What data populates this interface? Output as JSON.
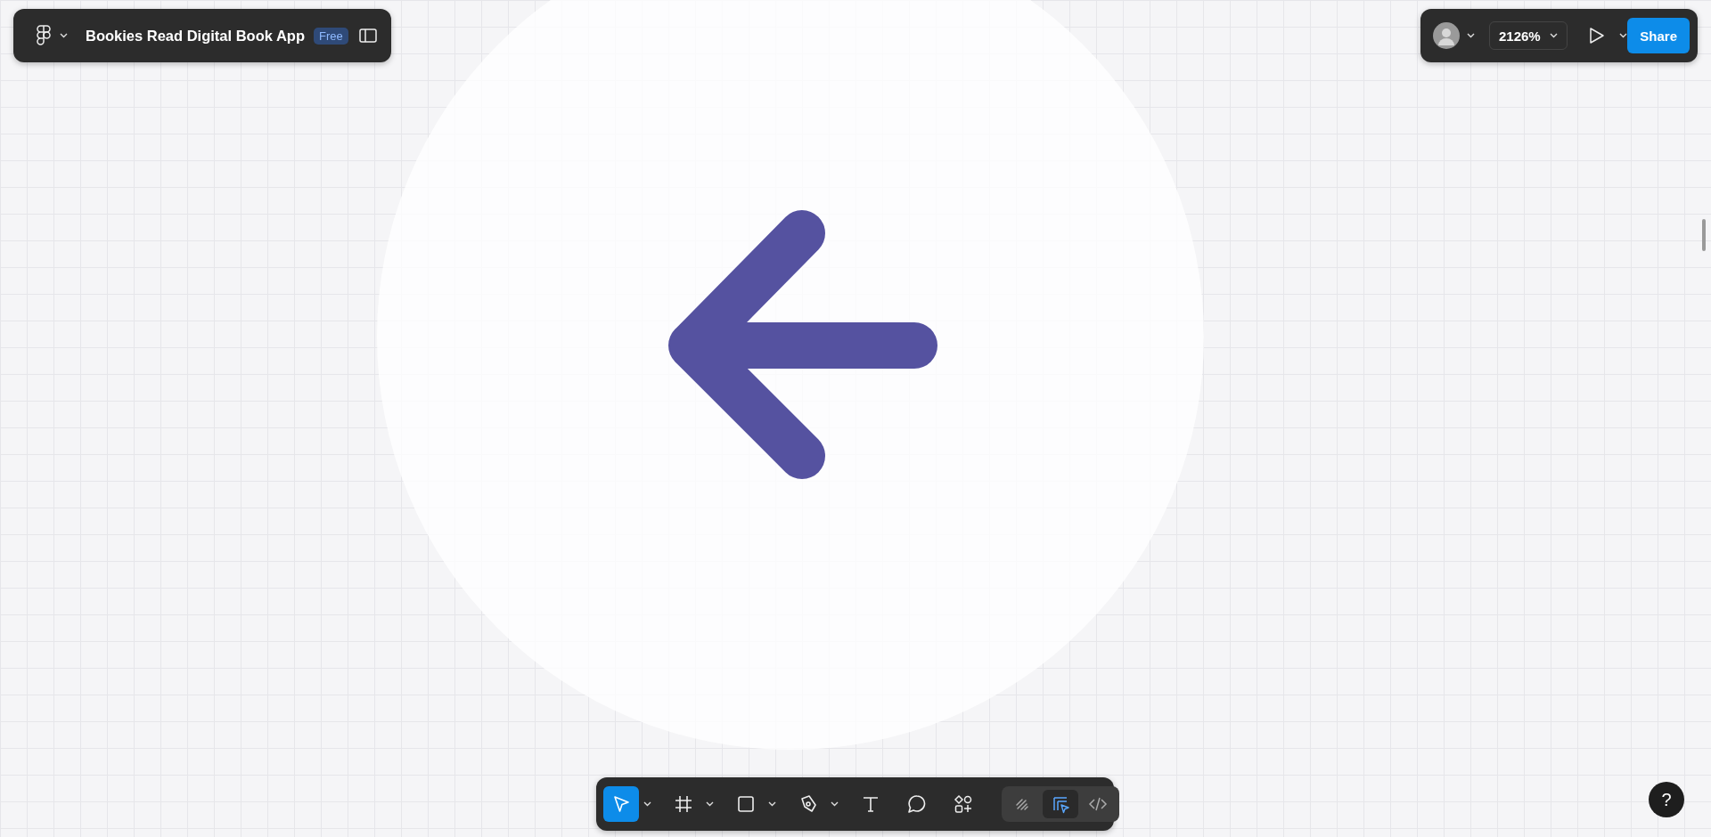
{
  "file_bar": {
    "file_name": "Bookies Read Digital Book App",
    "plan_badge": "Free"
  },
  "share_bar": {
    "zoom": "2126%",
    "share_button": "Share"
  },
  "toolbar": {
    "tools": [
      {
        "kind": "move",
        "selected": true,
        "has_menu": true
      },
      {
        "kind": "frame",
        "selected": false,
        "has_menu": true
      },
      {
        "kind": "rectangle",
        "selected": false,
        "has_menu": true
      },
      {
        "kind": "pen",
        "selected": false,
        "has_menu": true
      },
      {
        "kind": "text",
        "selected": false,
        "has_menu": false
      },
      {
        "kind": "comment",
        "selected": false,
        "has_menu": false
      },
      {
        "kind": "components",
        "selected": false,
        "has_menu": false
      }
    ],
    "modes": [
      {
        "kind": "draw",
        "selected": false
      },
      {
        "kind": "design",
        "selected": true
      },
      {
        "kind": "dev",
        "selected": false
      }
    ]
  },
  "help_button": "?"
}
